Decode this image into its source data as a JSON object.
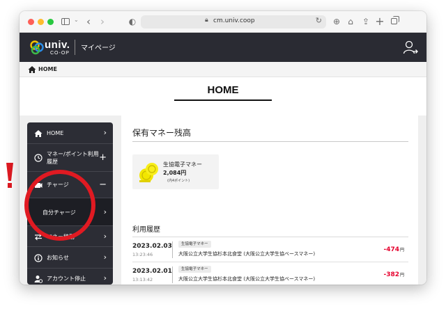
{
  "browser": {
    "url": "cm.univ.coop"
  },
  "header": {
    "logo_text": "univ.",
    "logo_sub": "CO-OP",
    "title": "マイページ"
  },
  "breadcrumb": {
    "home": "HOME"
  },
  "page": {
    "title": "HOME"
  },
  "sidebar": {
    "items": [
      {
        "label": "HOME",
        "icon": "home-icon",
        "action": "›"
      },
      {
        "label": "マネー/ポイント利用履歴",
        "label_line1": "マネー/ポイント利用",
        "label_line2": "履歴",
        "icon": "clock-icon",
        "action": "+"
      },
      {
        "label": "チャージ",
        "icon": "charge-icon",
        "action": "−"
      },
      {
        "label": "自分チャージ",
        "icon": "",
        "action": "›"
      },
      {
        "label": "マネー移動",
        "icon": "transfer-icon",
        "action": "›"
      },
      {
        "label": "お知らせ",
        "icon": "info-icon",
        "action": "›"
      },
      {
        "label": "アカウント停止",
        "icon": "user-stop-icon",
        "action": "›"
      }
    ]
  },
  "balance": {
    "section_title": "保有マネー残高",
    "label": "生協電子マネー",
    "amount": "2,084円",
    "points": "(内4ポイント)"
  },
  "history": {
    "section_title": "利用履歴",
    "rows": [
      {
        "date": "2023.02.03",
        "time": "13:23:46",
        "tag": "生協電子マネー",
        "desc": "大阪公立大学生協杉本北食堂 (大阪公立大学生協ベースマネー)",
        "amount": "-474",
        "unit": "円"
      },
      {
        "date": "2023.02.01",
        "time": "13:13:42",
        "tag": "生協電子マネー",
        "desc": "大阪公立大学生協杉本北食堂 (大阪公立大学生協ベースマネー)",
        "amount": "-382",
        "unit": "円"
      }
    ]
  },
  "annotation": {
    "exclamation": "!",
    "color": "#e01a22"
  }
}
